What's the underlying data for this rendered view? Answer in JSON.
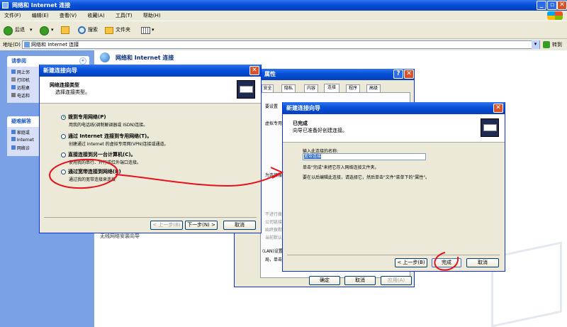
{
  "explorer": {
    "title": "网络和 Internet 连接",
    "menu": [
      "文件(F)",
      "编辑(E)",
      "查看(V)",
      "收藏(A)",
      "工具(T)",
      "帮助(H)"
    ],
    "back": "后退",
    "search": "搜索",
    "folders": "文件夹",
    "address_label": "地址(D)",
    "address": "网络和 Internet 连接",
    "go": "转到",
    "header": "网络和 Internet 连接"
  },
  "sidebar": {
    "see_also_title": "请参阅",
    "see_also": [
      "网上邻",
      "打印机",
      "远程桌",
      "电话和"
    ],
    "trouble_title": "疑难解答",
    "trouble": [
      "家庭或",
      "Internet",
      "网络诊"
    ],
    "bottom_text": "无线网络安装向导"
  },
  "props": {
    "title": "属性",
    "tabs": [
      "安全",
      "隐私",
      "内容",
      "连接",
      "程序",
      "高级"
    ],
    "frag1": "要设置",
    "frag2": "虚拟专用",
    "frag3": "为连接服",
    "lines": [
      "不进行拨",
      "公司链接",
      "始终拨默认",
      "当前默认："
    ],
    "lan": "(LAN)设置",
    "lan2": "局，单击上面",
    "ok": "确定",
    "cancel": "取消",
    "apply": "应用(A)"
  },
  "wizard1": {
    "title": "新建连接向导",
    "heading": "网络连接类型",
    "subheading": "选择连接类型。",
    "options": [
      {
        "label": "拨到专用网络(P)",
        "desc": "用我的电话线(调制解调器或 ISDN)连接。"
      },
      {
        "label": "通过 Internet 连接到专用网络(T)。",
        "desc": "创建通过 Internet 的虚拟专用网(VPN)连接或通道。"
      },
      {
        "label": "直接连接到另一台计算机(C)。",
        "desc": "使用我的串行、并行或红外端口连接。"
      },
      {
        "label": "通过宽带连接到网络(B)",
        "desc": "通过我的宽带连接来连接"
      }
    ],
    "back": "< 上一步(B)",
    "next": "下一步(N) >",
    "cancel": "取消"
  },
  "wizard2": {
    "title": "新建连接向导",
    "heading": "已完成",
    "subheading": "向导已准备好创建连接。",
    "name_label": "输入此连接的名称:",
    "name_value": "宽带连接",
    "line1": "单击\"完成\"来把它存入网络连接文件夹。",
    "line2": "要在以后编辑此连接，请选择它，然后单击\"文件\"菜单下的\"属性\"。",
    "back": "< 上一步(B)",
    "finish": "完成",
    "cancel": "取消"
  },
  "colors": {
    "xp_blue": "#0a53d8",
    "dialog_bg": "#ece9d8",
    "annotation_red": "#e8101a"
  }
}
